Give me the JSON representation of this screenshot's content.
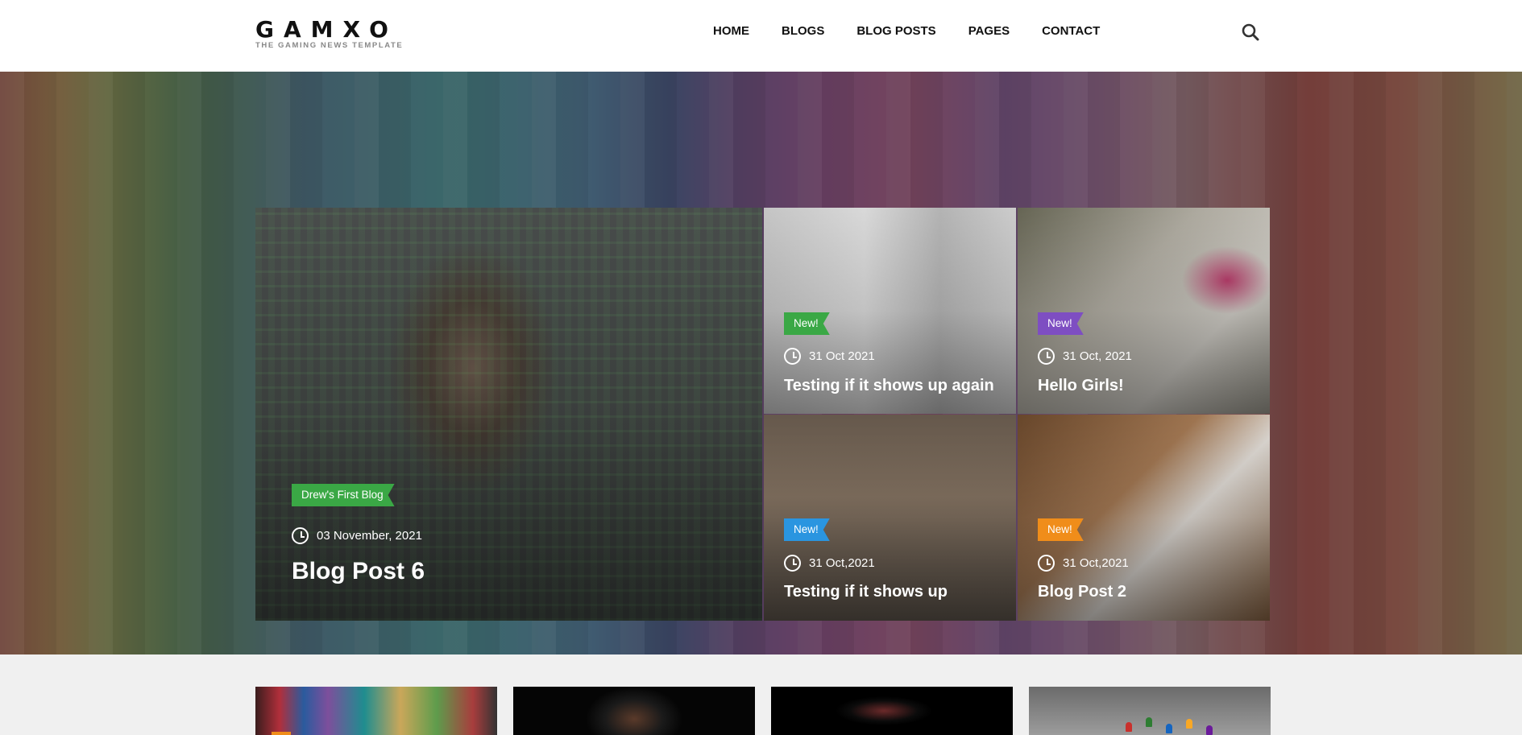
{
  "header": {
    "logo_text": "GAMXO",
    "logo_tagline": "THE GAMING NEWS TEMPLATE",
    "nav": [
      "HOME",
      "BLOGS",
      "BLOG POSTS",
      "PAGES",
      "CONTACT"
    ],
    "search_icon": "search-icon"
  },
  "featured": {
    "main": {
      "tag": "Drew's First Blog",
      "tag_color": "#3aa845",
      "date": "03 November, 2021",
      "title": "Blog Post 6"
    },
    "side": [
      {
        "tag": "New!",
        "tag_color": "#3aa845",
        "date": "31 Oct 2021",
        "title": "Testing if it shows up again"
      },
      {
        "tag": "New!",
        "tag_color": "#7e4ec2",
        "date": "31 Oct, 2021",
        "title": "Hello Girls!"
      },
      {
        "tag": "New!",
        "tag_color": "#2a95e0",
        "date": "31 Oct,2021",
        "title": "Testing if it shows up"
      },
      {
        "tag": "New!",
        "tag_color": "#f08d1a",
        "date": "31 Oct,2021",
        "title": "Blog Post 2"
      }
    ]
  },
  "colors": {
    "accent_green": "#3aa845",
    "accent_purple": "#7e4ec2",
    "accent_blue": "#2a95e0",
    "accent_orange": "#f08d1a"
  }
}
